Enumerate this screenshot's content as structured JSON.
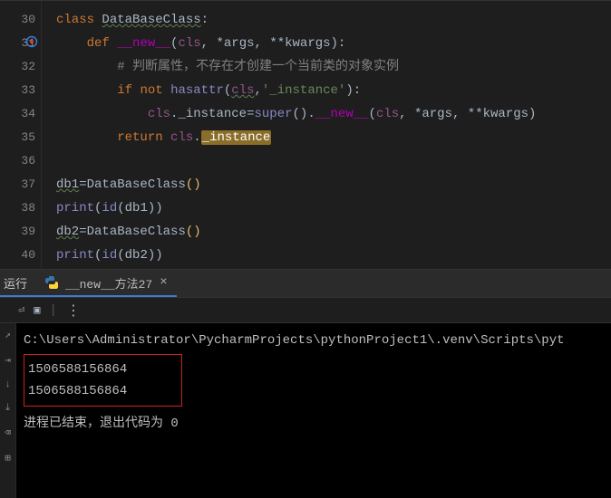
{
  "gutter": {
    "lines": [
      "30",
      "31",
      "32",
      "33",
      "34",
      "35",
      "36",
      "37",
      "38",
      "39",
      "40"
    ]
  },
  "code": {
    "l30": {
      "kw_class": "class",
      "cls_name": "DataBaseClass",
      "colon": ":"
    },
    "l31": {
      "kw_def": "def",
      "fn_name": "__new__",
      "lp": "(",
      "p_cls": "cls",
      "c1": ", ",
      "p_args": "*args",
      "c2": ", ",
      "p_kwargs": "**kwargs",
      "rp": "):"
    },
    "l32": {
      "hash": "# ",
      "txt": "判断属性，不存在才创建一个当前类的对象实例"
    },
    "l33": {
      "kw_if": "if",
      "sp1": " ",
      "kw_not": "not",
      "sp2": " ",
      "fn_hasattr": "hasattr",
      "lp": "(",
      "p_cls": "cls",
      "c1": ",",
      "str": "'_instance'",
      "rp": "):"
    },
    "l34": {
      "p_cls": "cls",
      "dot1": ".",
      "attr": "_instance",
      "eq": "=",
      "fn_super": "super",
      "lp1": "()",
      "dot2": ".",
      "fn_new": "__new__",
      "lp2": "(",
      "p_cls2": "cls",
      "c1": ", ",
      "p_args": "*args",
      "c2": ", ",
      "p_kwargs": "**kwargs",
      "rp": ")"
    },
    "l35": {
      "kw_return": "return",
      "sp": " ",
      "p_cls": "cls",
      "dot": ".",
      "attr": "_instance"
    },
    "l37": {
      "var": "db1",
      "eq": "=",
      "cls_name": "DataBaseClass",
      "paren": "()"
    },
    "l38": {
      "fn_print": "print",
      "lp": "(",
      "fn_id": "id",
      "lp2": "(",
      "var": "db1",
      "rp2": ")",
      "rp": ")"
    },
    "l39": {
      "var": "db2",
      "eq": "=",
      "cls_name": "DataBaseClass",
      "paren": "()"
    },
    "l40": {
      "fn_print": "print",
      "lp": "(",
      "fn_id": "id",
      "lp2": "(",
      "var": "db2",
      "rp2": ")",
      "rp": ")"
    }
  },
  "tabs": {
    "run_label": "运行",
    "file_name": "__new__方法27",
    "close": "×"
  },
  "toolbar": {
    "dots": "⋮"
  },
  "console": {
    "path": "C:\\Users\\Administrator\\PycharmProjects\\pythonProject1\\.venv\\Scripts\\pyt",
    "out1": "1506588156864",
    "out2": "1506588156864",
    "exit_prefix": "进程已结束，退出代码为 ",
    "exit_code": "0"
  },
  "action_icons": {
    "i1": "↗",
    "i2": "⇥",
    "i3": "↓",
    "i4": "⤓",
    "i5": "⌫",
    "i6": "⊞"
  }
}
